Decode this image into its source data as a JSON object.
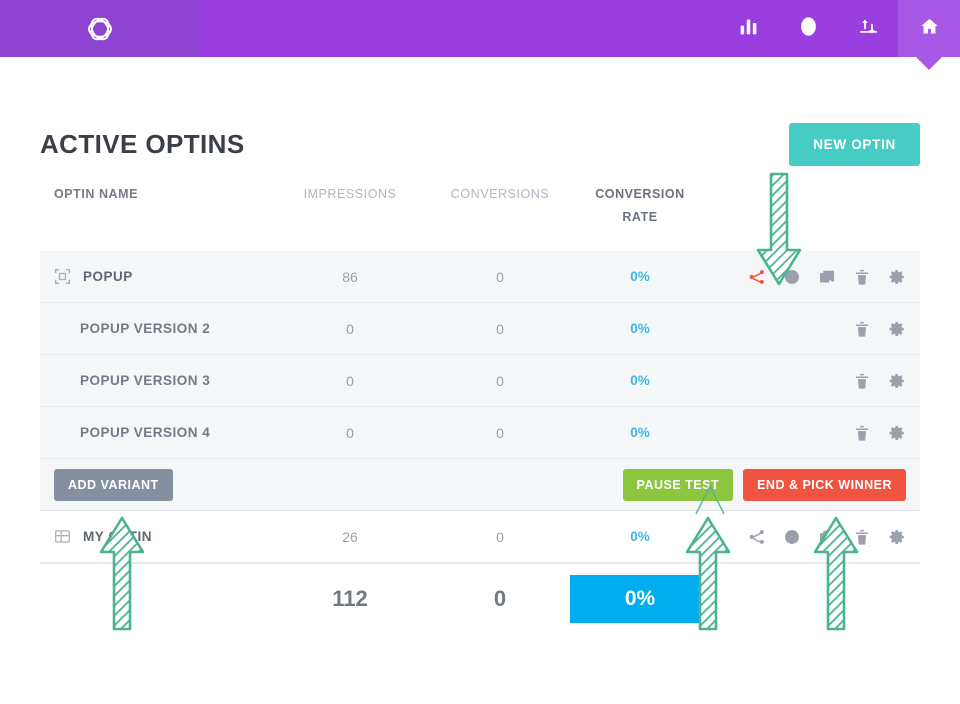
{
  "topbar": {
    "logo_icon": "optinmonster-logo-icon",
    "background_color": "#9b3ee0",
    "logo_block_color": "#8e44d0",
    "nav": [
      {
        "icon": "bar-chart-icon",
        "label": "Analytics",
        "active": false
      },
      {
        "icon": "user-circle-icon",
        "label": "Account",
        "active": false
      },
      {
        "icon": "transfer-icon",
        "label": "Transfer",
        "active": false
      },
      {
        "icon": "home-icon",
        "label": "Dashboard",
        "active": true
      }
    ]
  },
  "header": {
    "title": "ACTIVE OPTINS",
    "new_optin_label": "NEW OPTIN",
    "new_optin_color": "#46ccc4"
  },
  "table": {
    "columns": {
      "name": "OPTIN NAME",
      "impressions": "IMPRESSIONS",
      "conversions": "CONVERSIONS",
      "rate_line1": "CONVERSION",
      "rate_line2": "RATE"
    },
    "rows": [
      {
        "kind": "parent",
        "type_icon": "popup-lightbox-icon",
        "name": "POPUP",
        "impressions": "86",
        "conversions": "0",
        "rate": "0%",
        "actions": [
          "split-test-icon",
          "disable-icon",
          "duplicate-icon",
          "trash-icon",
          "gear-icon"
        ],
        "split_test_color": "#f0533f"
      },
      {
        "kind": "variant",
        "name": "POPUP VERSION 2",
        "impressions": "0",
        "conversions": "0",
        "rate": "0%",
        "actions": [
          "trash-icon",
          "gear-icon"
        ]
      },
      {
        "kind": "variant",
        "name": "POPUP VERSION 3",
        "impressions": "0",
        "conversions": "0",
        "rate": "0%",
        "actions": [
          "trash-icon",
          "gear-icon"
        ]
      },
      {
        "kind": "variant",
        "name": "POPUP VERSION 4",
        "impressions": "0",
        "conversions": "0",
        "rate": "0%",
        "actions": [
          "trash-icon",
          "gear-icon"
        ]
      }
    ],
    "variant_bar": {
      "add_variant_label": "ADD VARIANT",
      "add_variant_color": "#868fa0",
      "pause_test_label": "PAUSE TEST",
      "pause_test_color": "#8cc63e",
      "end_pick_winner_label": "END & PICK WINNER",
      "end_pick_winner_color": "#f0533f"
    },
    "second_optin": {
      "type_icon": "sidebar-grid-icon",
      "name": "MY OPTIN",
      "impressions": "26",
      "conversions": "0",
      "rate": "0%",
      "actions": [
        "split-test-icon",
        "disable-icon",
        "duplicate-icon",
        "trash-icon",
        "gear-icon"
      ]
    },
    "totals": {
      "impressions": "112",
      "conversions": "0",
      "rate": "0%",
      "rate_badge_color": "#00aeef"
    }
  },
  "annotations": {
    "color": "#4cb391",
    "arrows": [
      {
        "name": "arrow-pointing-to-split-test-icon",
        "direction": "down"
      },
      {
        "name": "arrow-pointing-to-add-variant-button",
        "direction": "up"
      },
      {
        "name": "arrow-pointing-to-pause-test-button",
        "direction": "up"
      },
      {
        "name": "arrow-pointing-to-end-pick-winner-button",
        "direction": "up"
      }
    ]
  }
}
